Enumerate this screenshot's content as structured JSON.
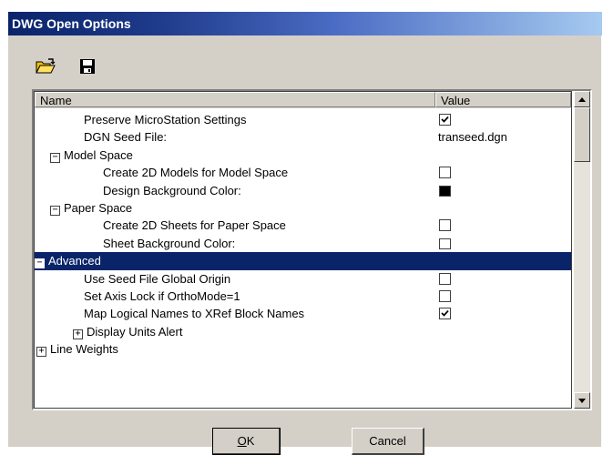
{
  "window": {
    "title": "DWG Open Options"
  },
  "toolbar": {
    "open_icon": "open-folder-icon",
    "save_icon": "floppy-disk-icon"
  },
  "table": {
    "headers": {
      "name": "Name",
      "value": "Value"
    },
    "rows": [
      {
        "label": "Preserve MicroStation Settings",
        "type": "checkbox",
        "checked": true
      },
      {
        "label": "DGN Seed File:",
        "type": "text",
        "value": "transeed.dgn"
      },
      {
        "label": "Model Space",
        "type": "group",
        "expander": "⊟"
      },
      {
        "label": "Create 2D Models for Model Space",
        "type": "checkbox",
        "checked": false
      },
      {
        "label": "Design Background Color:",
        "type": "color",
        "color": "#000000"
      },
      {
        "label": "Paper Space",
        "type": "group",
        "expander": "⊟"
      },
      {
        "label": "Create 2D Sheets for Paper Space",
        "type": "checkbox",
        "checked": false
      },
      {
        "label": "Sheet Background Color:",
        "type": "color",
        "color": "#ffffff"
      },
      {
        "label": "Advanced",
        "type": "group",
        "expander": "⊟",
        "selected": true
      },
      {
        "label": "Use Seed File Global Origin",
        "type": "checkbox",
        "checked": false
      },
      {
        "label": "Set Axis Lock if OrthoMode=1",
        "type": "checkbox",
        "checked": false
      },
      {
        "label": "Map Logical Names to XRef Block Names",
        "type": "checkbox",
        "checked": true
      },
      {
        "label": "Display Units Alert",
        "type": "group",
        "expander": "⊞"
      },
      {
        "label": "Line Weights",
        "type": "group",
        "expander": "⊞"
      }
    ]
  },
  "buttons": {
    "ok_mnemonic": "O",
    "ok_rest": "K",
    "cancel": "Cancel"
  },
  "colors": {
    "selection": "#0a246a",
    "dialog": "#d4d0c8"
  }
}
